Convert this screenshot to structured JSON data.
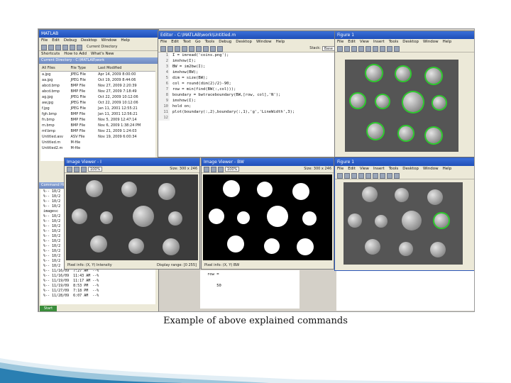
{
  "caption": "Example of above explained commands",
  "matlab": {
    "title": "MATLAB",
    "menu": [
      "File",
      "Edit",
      "Debug",
      "Desktop",
      "Window",
      "Help"
    ],
    "shortcuts": "Shortcuts",
    "how_to_add": "How to Add",
    "whats_new": "What's New",
    "current_directory_label": "Current Directory",
    "current_dir_title": "Current Directory - C:\\MATLAB\\work",
    "file_columns": [
      "All Files",
      "File Type",
      "Last Modified"
    ],
    "files": [
      [
        "a.jpg",
        "JPEG File",
        "Apr 14, 2009 8:00:00"
      ],
      [
        "aa.jpg",
        "JPEG File",
        "Oct 19, 2009 8:44:06"
      ],
      [
        "abcd.bmp",
        "BMP File",
        "Nov 27, 2009 2:20:39"
      ],
      [
        "abcd.bmp",
        "BMP File",
        "Nov 27, 2009 7:18:49"
      ],
      [
        "ag.jpg",
        "JPEG File",
        "Oct 22, 2009 10:12:06"
      ],
      [
        "aw.jpg",
        "JPEG File",
        "Oct 22, 2009 10:12:06"
      ],
      [
        "f.jpg",
        "JPEG File",
        "Jan 11, 2001 12:55:21"
      ],
      [
        "fgh.bmp",
        "BMP File",
        "Jan 11, 2001 12:56:21"
      ],
      [
        "fn.bmp",
        "BMP File",
        "Nov 5, 2009 12:47:14"
      ],
      [
        "m.bmp",
        "BMP File",
        "Nov 6, 2009 1:38:24 PM"
      ],
      [
        "mf.bmp",
        "BMP File",
        "Nov 21, 2009 1:24:03"
      ],
      [
        "Untitled.asv",
        "ASV File",
        "Nov 19, 2009 6:00:34"
      ],
      [
        "Untitled.m",
        "M-file",
        ""
      ],
      [
        "Untitled2.m",
        "M-file",
        ""
      ]
    ],
    "command_history_label": "Command History",
    "history": [
      "%-- 10/2",
      "%-- 10/2",
      "%-- 10/2",
      "%-- 10/2",
      "imagesc",
      "%-- 10/2",
      "%-- 10/2",
      "%-- 10/2",
      "%-- 10/2",
      "%-- 10/2",
      "%-- 10/2",
      "%-- 10/2",
      "%-- 10/2",
      "%-- 10/2",
      "%-- 10/2",
      "%-- 10/2",
      "%-- 11/16/09  7:27 AM  --%",
      "%-- 11/16/09  11:43 AM --%",
      "%-- 11/19/09  11:17 AM --%",
      "%-- 11/19/09  8:53 PM  --%",
      "%-- 11/27/09  7:18 PM  --%",
      "%-- 11/28/09  6:07 AM  --%"
    ],
    "start_label": "Start"
  },
  "editor": {
    "title": "Editor - C:\\MATLAB\\work\\Untitled.m",
    "menu": [
      "File",
      "Edit",
      "Text",
      "Go",
      "Tools",
      "Debug",
      "Desktop",
      "Window",
      "Help"
    ],
    "stack_label": "Stack:",
    "stack_value": "Base",
    "line_numbers": [
      "1",
      "2",
      "3",
      "4",
      "5",
      "6",
      "7",
      "8",
      "9",
      "10",
      "11",
      "12"
    ],
    "code": [
      "I = imread('coins.png');",
      "imshow(I);",
      "BW = im2bw(I);",
      "imshow(BW);",
      "dim = size(BW);",
      "col = round(dim(2)/2)-90;",
      "row = min(find(BW(:,col)));",
      "boundary = bwtraceboundary(BW,[row, col],'N');",
      "imshow(I);",
      "hold on;",
      "plot(boundary(:,2),boundary(:,1),'g','LineWidth',3);",
      ""
    ]
  },
  "command_window": {
    "lines": [
      "row =",
      "",
      "    50"
    ]
  },
  "figure1_top": {
    "title": "Figure 1",
    "menu": [
      "File",
      "Edit",
      "View",
      "Insert",
      "Tools",
      "Desktop",
      "Window",
      "Help"
    ]
  },
  "image_viewer_1": {
    "title": "Image Viewer - I",
    "zoom": "100%",
    "size_label": "Size: 300 x 246",
    "pixel_info": "Pixel info: (X, Y) Intensity",
    "display_range": "Display range: [0 255]"
  },
  "image_viewer_2": {
    "title": "Image Viewer - BW",
    "zoom": "100%",
    "size_label": "Size: 300 x 246",
    "pixel_info": "Pixel info: (X, Y) BW"
  },
  "figure1_bottom": {
    "title": "Figure 1",
    "menu": [
      "File",
      "Edit",
      "View",
      "Insert",
      "Tools",
      "Desktop",
      "Window",
      "Help"
    ]
  }
}
